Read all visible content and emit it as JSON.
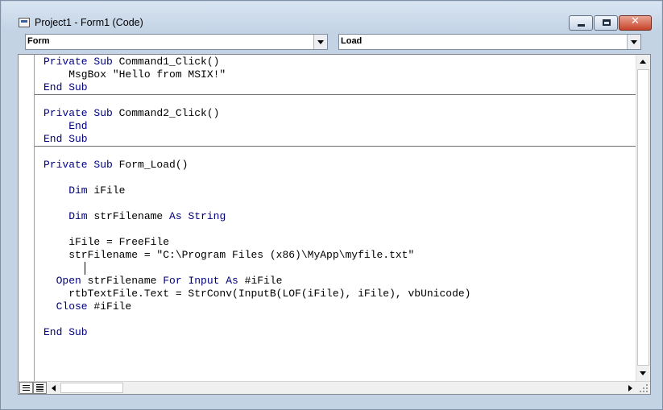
{
  "window": {
    "title": "Project1 - Form1 (Code)",
    "close_glyph": "✕"
  },
  "object_combo": {
    "value": "Form"
  },
  "procedure_combo": {
    "value": "Load"
  },
  "code": {
    "lines": [
      {
        "kw": "Private Sub ",
        "text": "Command1_Click()"
      },
      {
        "text": "    MsgBox \"Hello from MSIX!\""
      },
      {
        "kw": "End Sub",
        "text": ""
      },
      {
        "kw": "Private Sub ",
        "text": "Command2_Click()"
      },
      {
        "kw": "    End",
        "text": ""
      },
      {
        "kw": "End Sub",
        "text": ""
      },
      {
        "kw": "Private Sub ",
        "text": "Form_Load()"
      },
      {
        "kw": "    Dim ",
        "text": "iFile"
      },
      {
        "kw": "    Dim ",
        "text": "strFilename ",
        "kw2": "As String"
      },
      {
        "text": "    iFile = FreeFile"
      },
      {
        "text": "    strFilename = \"C:\\Program Files (x86)\\MyApp\\myfile.txt\""
      },
      {
        "kw": "  Open ",
        "text": "strFilename ",
        "kw2": "For Input As ",
        "text2": "#iFile"
      },
      {
        "text": "    rtbTextFile.Text = StrConv(InputB(LOF(iFile), iFile), vbUnicode)"
      },
      {
        "kw": "  Close ",
        "text": "#iFile"
      },
      {
        "kw": "End Sub",
        "text": ""
      }
    ]
  },
  "colors": {
    "keyword": "#00007f",
    "text": "#000000",
    "frame": "#c3d3e4"
  },
  "icons": {
    "app": "vb-code-window-icon",
    "minimize": "minimize-icon",
    "maximize": "maximize-icon",
    "close": "close-icon"
  }
}
